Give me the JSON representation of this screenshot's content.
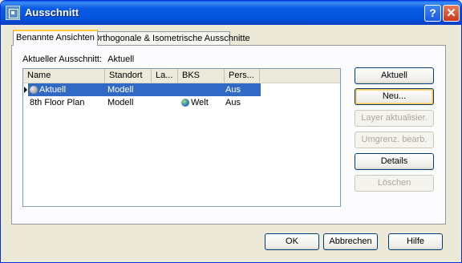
{
  "window": {
    "title": "Ausschnitt",
    "help_glyph": "?",
    "close_glyph": "✕"
  },
  "tabs": [
    {
      "label": "Benannte Ansichten",
      "active": true
    },
    {
      "label": "Orthogonale & Isometrische Ausschnitte",
      "active": false
    }
  ],
  "current": {
    "label": "Aktueller Ausschnitt:",
    "value": "Aktuell"
  },
  "list": {
    "columns": [
      "Name",
      "Standort",
      "La...",
      "BKS",
      "Pers..."
    ],
    "rows": [
      {
        "name": "Aktuell",
        "standort": "Modell",
        "layer": "",
        "bks": "",
        "pers": "Aus",
        "selected": true
      },
      {
        "name": "8th Floor Plan",
        "standort": "Modell",
        "layer": "",
        "bks": "Welt",
        "pers": "Aus",
        "selected": false
      }
    ]
  },
  "side_buttons": [
    {
      "label": "Aktuell",
      "enabled": true
    },
    {
      "label": "Neu...",
      "enabled": true
    },
    {
      "label": "Layer aktualisier.",
      "enabled": false
    },
    {
      "label": "Umgrenz. bearb.",
      "enabled": false
    },
    {
      "label": "Details",
      "enabled": true
    },
    {
      "label": "Löschen",
      "enabled": false
    }
  ],
  "bottom_buttons": {
    "ok": "OK",
    "cancel": "Abbrechen",
    "help": "Hilfe"
  }
}
